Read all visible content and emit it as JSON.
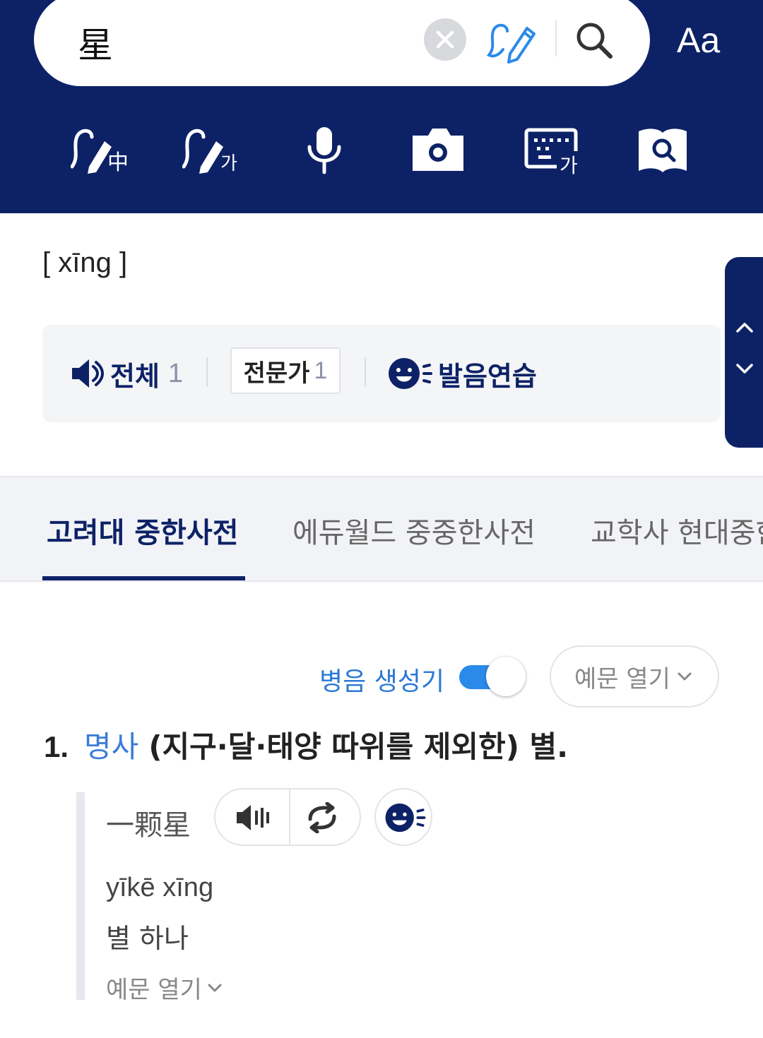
{
  "search": {
    "query": "星",
    "font_button": "Aa"
  },
  "toolbar": {
    "tools": [
      {
        "name": "chinese-handwriting",
        "glyph": "中"
      },
      {
        "name": "korean-handwriting",
        "glyph": "가"
      },
      {
        "name": "voice-search"
      },
      {
        "name": "image-search"
      },
      {
        "name": "korean-keyboard",
        "glyph": "가"
      },
      {
        "name": "dictionary-search"
      }
    ]
  },
  "entry": {
    "pinyin": "[ xīng ]",
    "sound": {
      "all_label": "전체",
      "all_count": "1",
      "expert_label": "전문가",
      "expert_count": "1",
      "practice_label": "발음연습"
    }
  },
  "dict_tabs": [
    {
      "label": "고려대 중한사전",
      "active": true
    },
    {
      "label": "에듀월드 중중한사전",
      "active": false
    },
    {
      "label": "교학사 현대중한",
      "active": false
    }
  ],
  "options": {
    "pinyin_generator_label": "병음 생성기",
    "pinyin_generator_on": true,
    "example_open_label": "예문 열기"
  },
  "definitions": [
    {
      "number": "1.",
      "pos": "명사",
      "text": "(지구·달·태양 따위를 제외한) 별.",
      "example": {
        "word": "一颗星",
        "pinyin": "yīkē xīng",
        "meaning": "별 하나",
        "open_label": "예문 열기"
      }
    }
  ],
  "colors": {
    "brand_navy": "#0d2266",
    "accent_blue": "#2a8aea",
    "pos_blue": "#3b7dd8"
  }
}
